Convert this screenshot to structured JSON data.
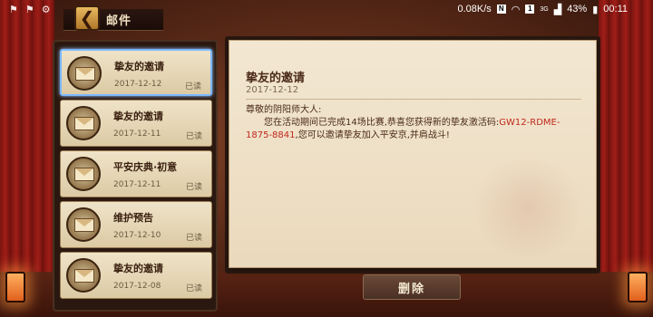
{
  "status_bar": {
    "speed": "0.08K/s",
    "n_icon": "N",
    "box_icon": "1",
    "network": "3G",
    "battery": "43%",
    "time": "00:11"
  },
  "header": {
    "title": "邮件",
    "back_icon": "back-arrow-icon"
  },
  "mail_list": {
    "items": [
      {
        "title": "挚友的邀请",
        "date": "2017-12-12",
        "status": "已读",
        "selected": true
      },
      {
        "title": "挚友的邀请",
        "date": "2017-12-11",
        "status": "已读",
        "selected": false
      },
      {
        "title": "平安庆典·初意",
        "date": "2017-12-11",
        "status": "已读",
        "selected": false
      },
      {
        "title": "维护预告",
        "date": "2017-12-10",
        "status": "已读",
        "selected": false
      },
      {
        "title": "挚友的邀请",
        "date": "2017-12-08",
        "status": "已读",
        "selected": false
      }
    ]
  },
  "detail": {
    "title": "挚友的邀请",
    "date": "2017-12-12",
    "greeting": "尊敬的阴阳师大人:",
    "line1": "您在活动期间已完成14场比赛,恭喜您获得新的挚友激活码:",
    "code": "GW12-RDME-1875-8841",
    "line2": ",您可以邀请挚友加入平安京,并肩战斗!"
  },
  "actions": {
    "delete_label": "删除"
  },
  "colors": {
    "accent_red": "#c0281c",
    "selected_border": "#7ab8ff",
    "paper": "#f3e7d2"
  }
}
